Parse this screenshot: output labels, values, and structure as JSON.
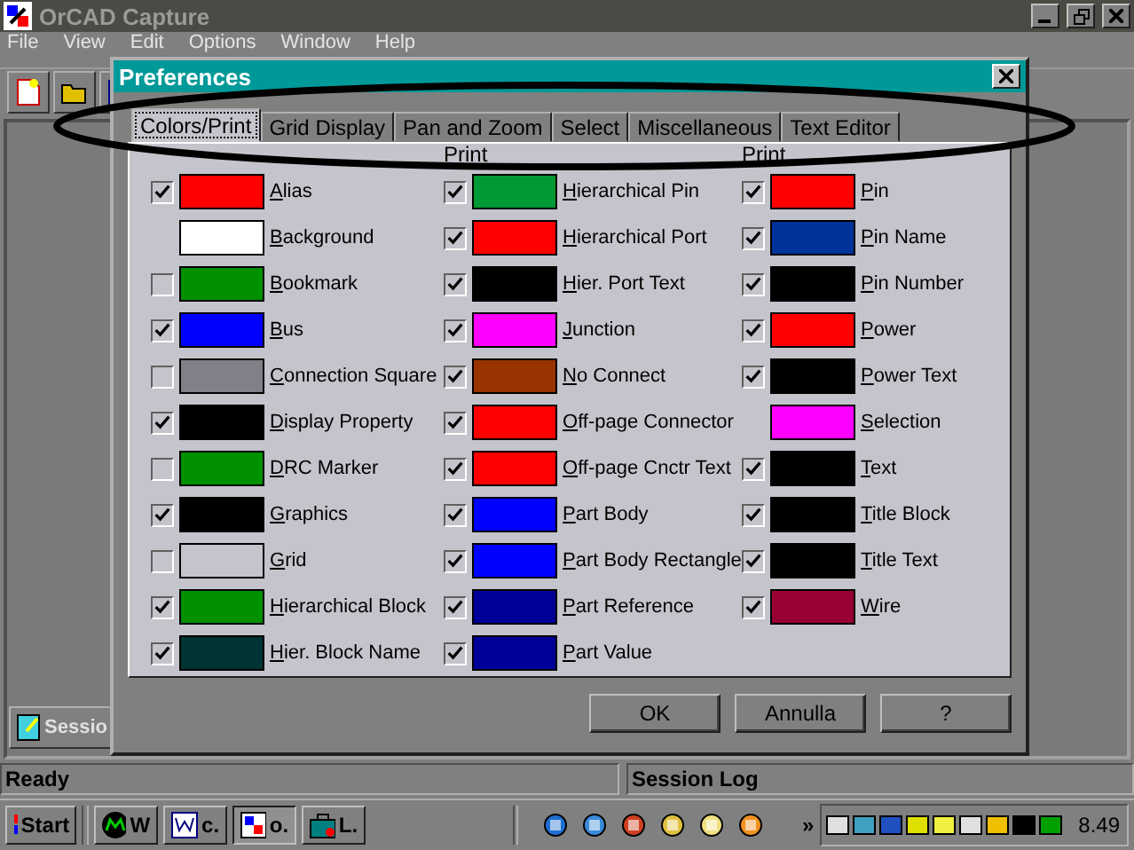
{
  "window": {
    "title": "OrCAD Capture"
  },
  "menu": [
    "File",
    "View",
    "Edit",
    "Options",
    "Window",
    "Help"
  ],
  "session_window": {
    "title": "Sessio"
  },
  "dialog": {
    "title": "Preferences",
    "tabs": [
      {
        "label": "Colors/Print",
        "selected": true
      },
      {
        "label": "Grid Display",
        "selected": false
      },
      {
        "label": "Pan and Zoom",
        "selected": false
      },
      {
        "label": "Select",
        "selected": false
      },
      {
        "label": "Miscellaneous",
        "selected": false
      },
      {
        "label": "Text Editor",
        "selected": false
      }
    ],
    "print_headers": [
      "Print",
      "Print"
    ],
    "columns": [
      [
        {
          "label": "Alias",
          "color": "#ff0000",
          "print": true
        },
        {
          "label": "Background",
          "color": "#ffffff"
        },
        {
          "label": "Bookmark",
          "color": "#009000",
          "print": false
        },
        {
          "label": "Bus",
          "color": "#0000ff",
          "print": true
        },
        {
          "label": "Connection Square",
          "color": "#808088",
          "print": false
        },
        {
          "label": "Display Property",
          "color": "#000000",
          "print": true
        },
        {
          "label": "DRC Marker",
          "color": "#009000",
          "print": false
        },
        {
          "label": "Graphics",
          "color": "#000000",
          "print": true
        },
        {
          "label": "Grid",
          "color": "#c4c4cc",
          "print": false
        },
        {
          "label": "Hierarchical Block",
          "color": "#009000",
          "print": true
        },
        {
          "label": "Hier. Block Name",
          "color": "#003333",
          "print": true
        }
      ],
      [
        {
          "label": "Hierarchical Pin",
          "color": "#009933",
          "print": true
        },
        {
          "label": "Hierarchical Port",
          "color": "#ff0000",
          "print": true
        },
        {
          "label": "Hier. Port Text",
          "color": "#000000",
          "print": true
        },
        {
          "label": "Junction",
          "color": "#ff00ff",
          "print": true
        },
        {
          "label": "No Connect",
          "color": "#993300",
          "print": true
        },
        {
          "label": "Off-page Connector",
          "color": "#ff0000",
          "print": true
        },
        {
          "label": "Off-page Cnctr Text",
          "color": "#ff0000",
          "print": true
        },
        {
          "label": "Part Body",
          "color": "#0000ff",
          "print": true
        },
        {
          "label": "Part Body Rectangle",
          "color": "#0000ff",
          "print": true
        },
        {
          "label": "Part Reference",
          "color": "#000099",
          "print": true
        },
        {
          "label": "Part Value",
          "color": "#000099",
          "print": true
        }
      ],
      [
        {
          "label": "Pin",
          "color": "#ff0000",
          "print": true
        },
        {
          "label": "Pin Name",
          "color": "#003399",
          "print": true
        },
        {
          "label": "Pin Number",
          "color": "#000000",
          "print": true
        },
        {
          "label": "Power",
          "color": "#ff0000",
          "print": true
        },
        {
          "label": "Power Text",
          "color": "#000000",
          "print": true
        },
        {
          "label": "Selection",
          "color": "#ff00ff"
        },
        {
          "label": "Text",
          "color": "#000000",
          "print": true
        },
        {
          "label": "Title Block",
          "color": "#000000",
          "print": true
        },
        {
          "label": "Title Text",
          "color": "#000000",
          "print": true
        },
        {
          "label": "Wire",
          "color": "#990033",
          "print": true
        }
      ]
    ],
    "buttons": [
      "OK",
      "Annulla",
      "?"
    ]
  },
  "status_bar": [
    "Ready",
    "Session Log"
  ],
  "taskbar": {
    "start": "Start",
    "tasks": [
      {
        "label": "W",
        "kind": "mx",
        "selected": false
      },
      {
        "label": "c.",
        "kind": "doc",
        "selected": false
      },
      {
        "label": "o.",
        "kind": "orcad",
        "selected": true
      },
      {
        "label": "L.",
        "kind": "tool",
        "selected": false
      }
    ],
    "more": "»",
    "clock": "8.49"
  }
}
